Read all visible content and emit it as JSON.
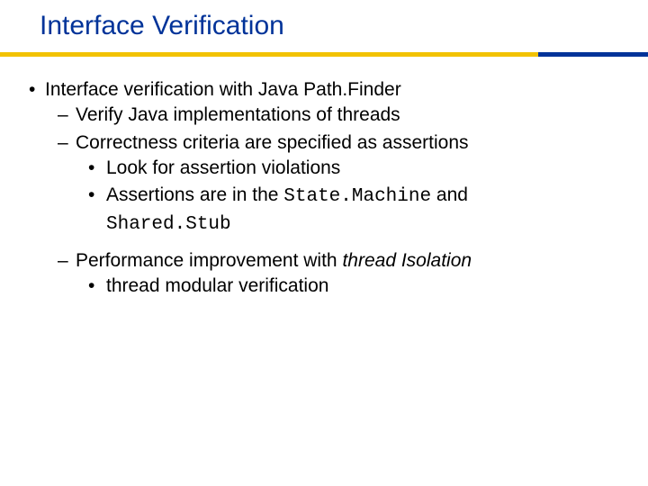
{
  "title": "Interface Verification",
  "bullets": {
    "l1": "Interface verification with Java Path.Finder",
    "l2a": "Verify Java implementations of threads",
    "l2b": "Correctness criteria are specified as assertions",
    "l3a": "Look for assertion violations",
    "l3b_pre": "Assertions are in the ",
    "l3b_code1": "State.Machine",
    "l3b_mid": " and ",
    "l3b_code2": "Shared.Stub",
    "l2c_pre": "Performance improvement with ",
    "l2c_ital": "thread Isolation",
    "l3c": "thread modular verification"
  }
}
